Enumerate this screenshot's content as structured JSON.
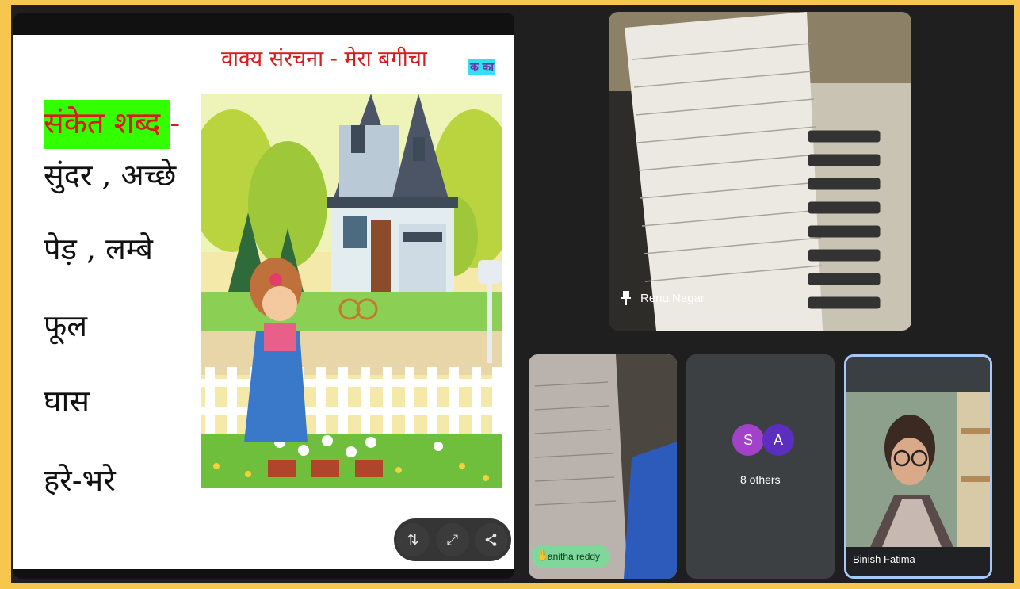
{
  "slide": {
    "title": "वाक्य संरचना - मेरा बगीचा",
    "badge": "क का",
    "header_word": "संकेत शब्द -",
    "words": [
      "सुंदर , अच्छे",
      "पेड़ , लम्बे",
      "फूल",
      "घास",
      "हरे-भरे"
    ]
  },
  "controls": {
    "swap_icon": "swap-vertical-icon",
    "fullscreen_icon": "expand-icon",
    "share_icon": "share-icon"
  },
  "participants": {
    "pinned": {
      "name": "Renu Nagar",
      "icon": "pin-icon"
    },
    "speaker": {
      "name": "anitha reddy",
      "icon": "hand-raise-icon"
    },
    "others": {
      "initials": [
        "S",
        "A"
      ],
      "label": "8 others"
    },
    "self": {
      "name": "Binish Fatima"
    }
  },
  "colors": {
    "background": "#f6c64e",
    "highlight": "#33ff00",
    "title_red": "#d91a1a",
    "avatar_s": "#a142c9",
    "avatar_a": "#5b2ebf",
    "hand_badge": "#7fd79b"
  }
}
